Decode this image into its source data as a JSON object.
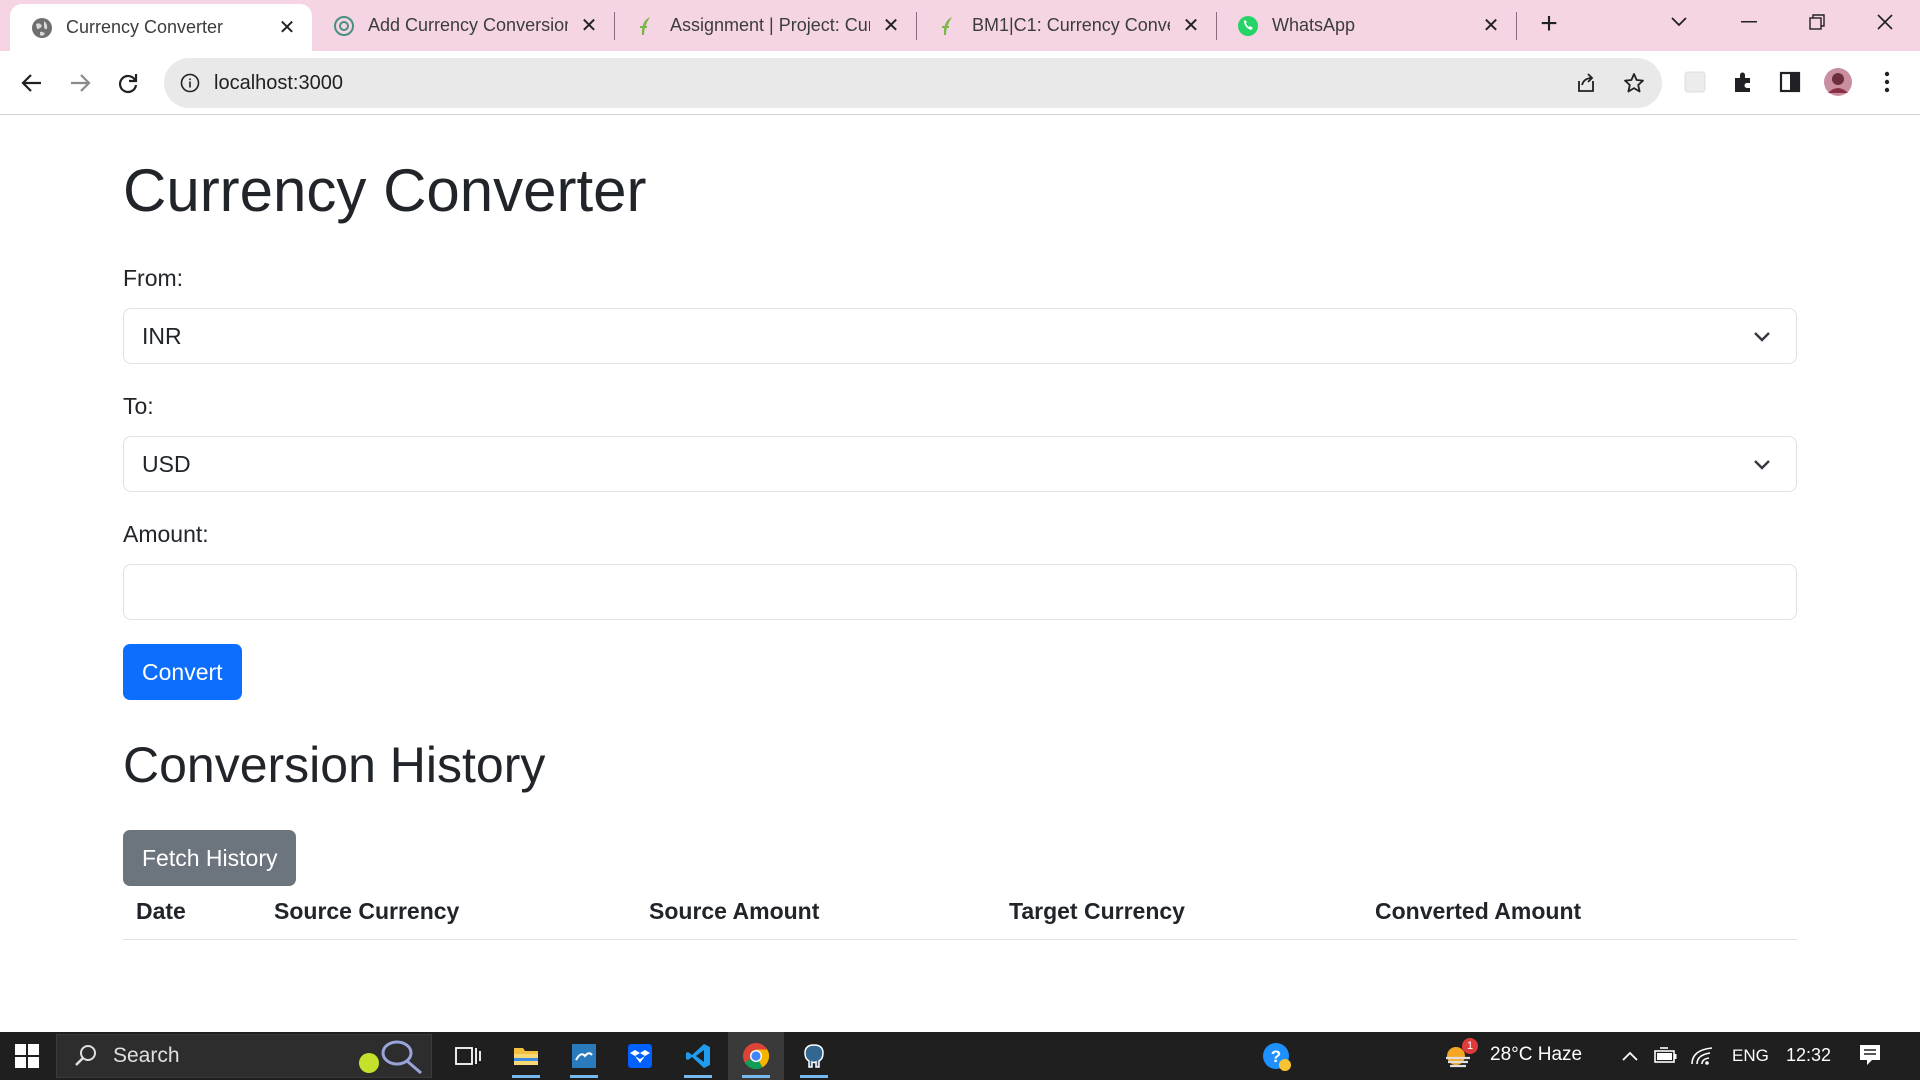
{
  "browser": {
    "tabs": [
      {
        "title": "Currency Converter",
        "active": true,
        "icon": "globe-icon"
      },
      {
        "title": "Add Currency Conversion",
        "active": false,
        "icon": "chatgpt-icon"
      },
      {
        "title": "Assignment | Project: Curr",
        "active": false,
        "icon": "feather-icon"
      },
      {
        "title": "BM1|C1: Currency Conver",
        "active": false,
        "icon": "feather-icon"
      },
      {
        "title": "WhatsApp",
        "active": false,
        "icon": "whatsapp-icon"
      }
    ],
    "new_tab": "+",
    "url": "localhost:3000"
  },
  "page": {
    "title": "Currency Converter",
    "from_label": "From:",
    "from_value": "INR",
    "to_label": "To:",
    "to_value": "USD",
    "amount_label": "Amount:",
    "amount_value": "",
    "convert_button": "Convert",
    "history_title": "Conversion History",
    "fetch_button": "Fetch History",
    "table_headers": [
      "Date",
      "Source Currency",
      "Source Amount",
      "Target Currency",
      "Converted Amount"
    ],
    "table_rows": []
  },
  "taskbar": {
    "search_placeholder": "Search",
    "weather": "28°C  Haze",
    "weather_badge": "1",
    "language": "ENG",
    "time": "12:32"
  },
  "colors": {
    "tab_strip": "#f5d5e4",
    "primary": "#0d6efd",
    "secondary": "#6c757d",
    "taskbar": "#1f1f1f"
  }
}
